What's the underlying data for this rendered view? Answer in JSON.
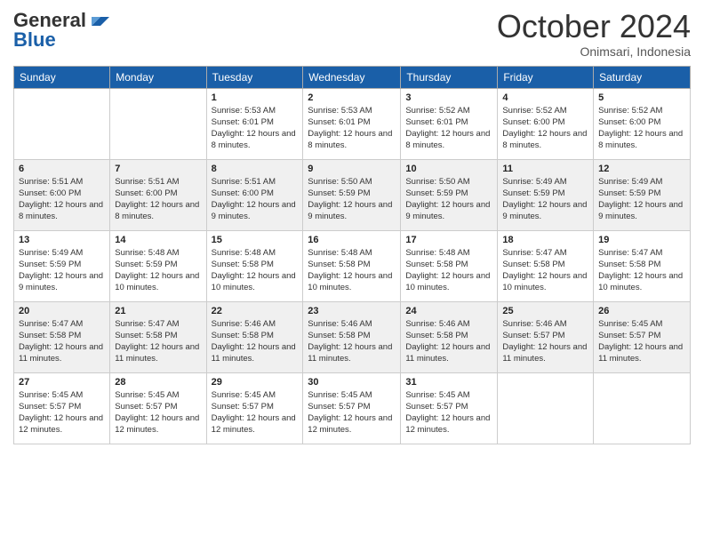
{
  "logo": {
    "general": "General",
    "blue": "Blue"
  },
  "header": {
    "month": "October 2024",
    "location": "Onimsari, Indonesia"
  },
  "days_of_week": [
    "Sunday",
    "Monday",
    "Tuesday",
    "Wednesday",
    "Thursday",
    "Friday",
    "Saturday"
  ],
  "weeks": [
    [
      null,
      null,
      {
        "day": 1,
        "sunrise": "5:53 AM",
        "sunset": "6:01 PM",
        "daylight": "12 hours and 8 minutes."
      },
      {
        "day": 2,
        "sunrise": "5:53 AM",
        "sunset": "6:01 PM",
        "daylight": "12 hours and 8 minutes."
      },
      {
        "day": 3,
        "sunrise": "5:52 AM",
        "sunset": "6:01 PM",
        "daylight": "12 hours and 8 minutes."
      },
      {
        "day": 4,
        "sunrise": "5:52 AM",
        "sunset": "6:00 PM",
        "daylight": "12 hours and 8 minutes."
      },
      {
        "day": 5,
        "sunrise": "5:52 AM",
        "sunset": "6:00 PM",
        "daylight": "12 hours and 8 minutes."
      }
    ],
    [
      {
        "day": 6,
        "sunrise": "5:51 AM",
        "sunset": "6:00 PM",
        "daylight": "12 hours and 8 minutes."
      },
      {
        "day": 7,
        "sunrise": "5:51 AM",
        "sunset": "6:00 PM",
        "daylight": "12 hours and 8 minutes."
      },
      {
        "day": 8,
        "sunrise": "5:51 AM",
        "sunset": "6:00 PM",
        "daylight": "12 hours and 9 minutes."
      },
      {
        "day": 9,
        "sunrise": "5:50 AM",
        "sunset": "5:59 PM",
        "daylight": "12 hours and 9 minutes."
      },
      {
        "day": 10,
        "sunrise": "5:50 AM",
        "sunset": "5:59 PM",
        "daylight": "12 hours and 9 minutes."
      },
      {
        "day": 11,
        "sunrise": "5:49 AM",
        "sunset": "5:59 PM",
        "daylight": "12 hours and 9 minutes."
      },
      {
        "day": 12,
        "sunrise": "5:49 AM",
        "sunset": "5:59 PM",
        "daylight": "12 hours and 9 minutes."
      }
    ],
    [
      {
        "day": 13,
        "sunrise": "5:49 AM",
        "sunset": "5:59 PM",
        "daylight": "12 hours and 9 minutes."
      },
      {
        "day": 14,
        "sunrise": "5:48 AM",
        "sunset": "5:59 PM",
        "daylight": "12 hours and 10 minutes."
      },
      {
        "day": 15,
        "sunrise": "5:48 AM",
        "sunset": "5:58 PM",
        "daylight": "12 hours and 10 minutes."
      },
      {
        "day": 16,
        "sunrise": "5:48 AM",
        "sunset": "5:58 PM",
        "daylight": "12 hours and 10 minutes."
      },
      {
        "day": 17,
        "sunrise": "5:48 AM",
        "sunset": "5:58 PM",
        "daylight": "12 hours and 10 minutes."
      },
      {
        "day": 18,
        "sunrise": "5:47 AM",
        "sunset": "5:58 PM",
        "daylight": "12 hours and 10 minutes."
      },
      {
        "day": 19,
        "sunrise": "5:47 AM",
        "sunset": "5:58 PM",
        "daylight": "12 hours and 10 minutes."
      }
    ],
    [
      {
        "day": 20,
        "sunrise": "5:47 AM",
        "sunset": "5:58 PM",
        "daylight": "12 hours and 11 minutes."
      },
      {
        "day": 21,
        "sunrise": "5:47 AM",
        "sunset": "5:58 PM",
        "daylight": "12 hours and 11 minutes."
      },
      {
        "day": 22,
        "sunrise": "5:46 AM",
        "sunset": "5:58 PM",
        "daylight": "12 hours and 11 minutes."
      },
      {
        "day": 23,
        "sunrise": "5:46 AM",
        "sunset": "5:58 PM",
        "daylight": "12 hours and 11 minutes."
      },
      {
        "day": 24,
        "sunrise": "5:46 AM",
        "sunset": "5:58 PM",
        "daylight": "12 hours and 11 minutes."
      },
      {
        "day": 25,
        "sunrise": "5:46 AM",
        "sunset": "5:57 PM",
        "daylight": "12 hours and 11 minutes."
      },
      {
        "day": 26,
        "sunrise": "5:45 AM",
        "sunset": "5:57 PM",
        "daylight": "12 hours and 11 minutes."
      }
    ],
    [
      {
        "day": 27,
        "sunrise": "5:45 AM",
        "sunset": "5:57 PM",
        "daylight": "12 hours and 12 minutes."
      },
      {
        "day": 28,
        "sunrise": "5:45 AM",
        "sunset": "5:57 PM",
        "daylight": "12 hours and 12 minutes."
      },
      {
        "day": 29,
        "sunrise": "5:45 AM",
        "sunset": "5:57 PM",
        "daylight": "12 hours and 12 minutes."
      },
      {
        "day": 30,
        "sunrise": "5:45 AM",
        "sunset": "5:57 PM",
        "daylight": "12 hours and 12 minutes."
      },
      {
        "day": 31,
        "sunrise": "5:45 AM",
        "sunset": "5:57 PM",
        "daylight": "12 hours and 12 minutes."
      },
      null,
      null
    ]
  ],
  "labels": {
    "sunrise": "Sunrise:",
    "sunset": "Sunset:",
    "daylight": "Daylight:"
  }
}
